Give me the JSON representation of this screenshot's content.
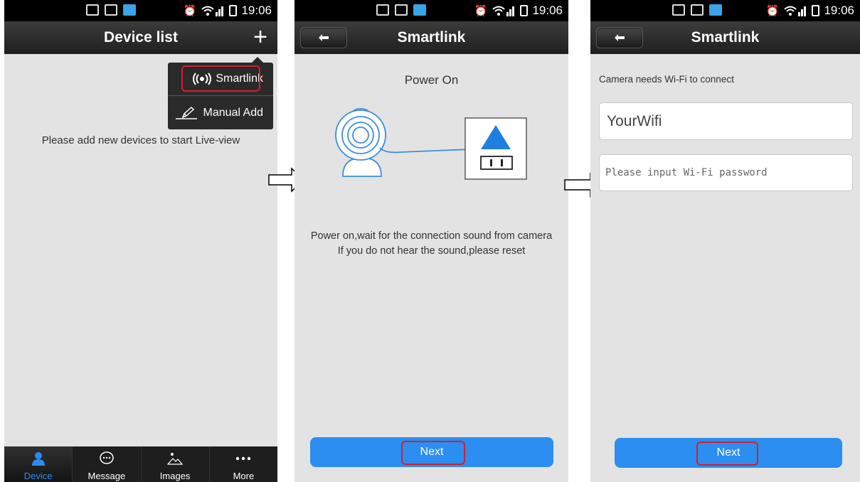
{
  "status_bar": {
    "time": "19:06"
  },
  "screen1": {
    "title": "Device list",
    "add_glyph": "+",
    "menu": [
      {
        "label": "Smartlink",
        "icon": "wifi-broadcast-icon"
      },
      {
        "label": "Manual Add",
        "icon": "pencil-icon"
      }
    ],
    "empty_message": "Please add new devices to start Live-view",
    "tabs": [
      {
        "label": "Device",
        "icon": "person-icon",
        "active": true
      },
      {
        "label": "Message",
        "icon": "chat-bubble-icon",
        "active": false
      },
      {
        "label": "Images",
        "icon": "image-icon",
        "active": false
      },
      {
        "label": "More",
        "icon": "more-dots-icon",
        "active": false
      }
    ]
  },
  "screen2": {
    "title": "Smartlink",
    "heading": "Power On",
    "instruction_line1": "Power on,wait for the connection sound from camera",
    "instruction_line2": "If you do not hear the sound,please reset",
    "next_label": "Next"
  },
  "screen3": {
    "title": "Smartlink",
    "prompt": "Camera needs Wi-Fi to connect",
    "ssid_value": "YourWifi",
    "password_placeholder": "Please input Wi-Fi password",
    "next_label": "Next"
  },
  "colors": {
    "accent_blue": "#2b8ef0",
    "highlight_red": "#d32030",
    "titlebar": "#2a2a2a",
    "screen_bg": "#e3e3e3"
  }
}
